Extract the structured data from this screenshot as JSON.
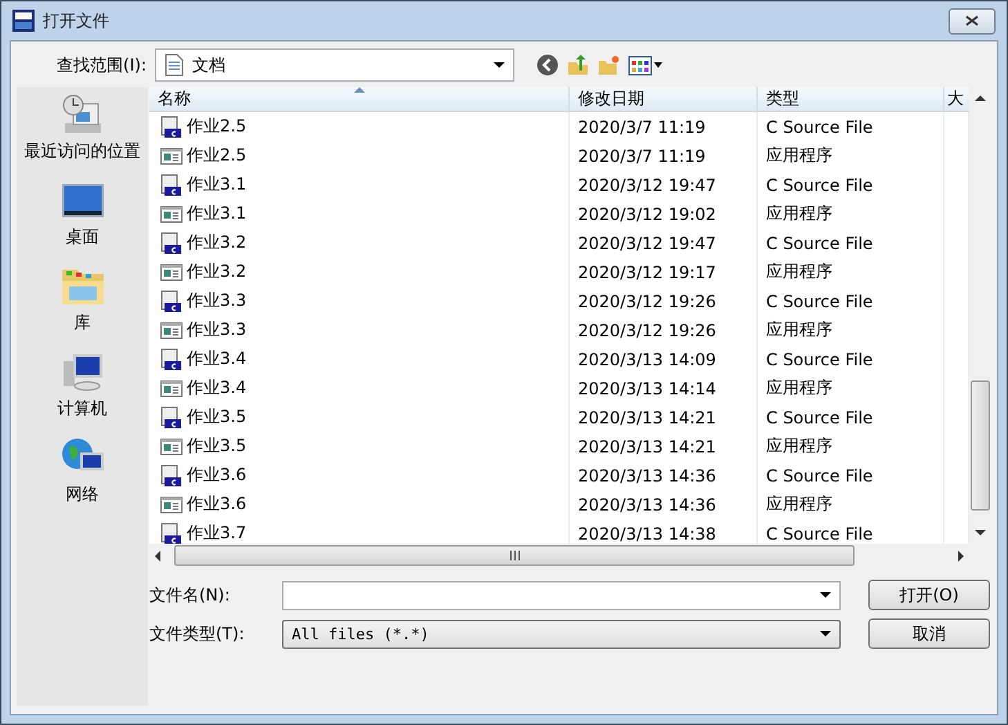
{
  "window": {
    "title": "打开文件"
  },
  "look_in": {
    "label": "查找范围(I):",
    "value": "文档"
  },
  "places": [
    {
      "kind": "recent",
      "label": "最近访问的位置"
    },
    {
      "kind": "desktop",
      "label": "桌面"
    },
    {
      "kind": "library",
      "label": "库"
    },
    {
      "kind": "computer",
      "label": "计算机"
    },
    {
      "kind": "network",
      "label": "网络"
    }
  ],
  "columns": [
    "名称",
    "修改日期",
    "类型",
    "大"
  ],
  "files": [
    {
      "kind": "source",
      "name": "作业2.5",
      "date": "2020/3/7 11:19",
      "type": "C Source File"
    },
    {
      "kind": "exe",
      "name": "作业2.5",
      "date": "2020/3/7 11:19",
      "type": "应用程序"
    },
    {
      "kind": "source",
      "name": "作业3.1",
      "date": "2020/3/12 19:47",
      "type": "C Source File"
    },
    {
      "kind": "exe",
      "name": "作业3.1",
      "date": "2020/3/12 19:02",
      "type": "应用程序"
    },
    {
      "kind": "source",
      "name": "作业3.2",
      "date": "2020/3/12 19:47",
      "type": "C Source File"
    },
    {
      "kind": "exe",
      "name": "作业3.2",
      "date": "2020/3/12 19:17",
      "type": "应用程序"
    },
    {
      "kind": "source",
      "name": "作业3.3",
      "date": "2020/3/12 19:26",
      "type": "C Source File"
    },
    {
      "kind": "exe",
      "name": "作业3.3",
      "date": "2020/3/12 19:26",
      "type": "应用程序"
    },
    {
      "kind": "source",
      "name": "作业3.4",
      "date": "2020/3/13 14:09",
      "type": "C Source File"
    },
    {
      "kind": "exe",
      "name": "作业3.4",
      "date": "2020/3/13 14:14",
      "type": "应用程序"
    },
    {
      "kind": "source",
      "name": "作业3.5",
      "date": "2020/3/13 14:21",
      "type": "C Source File"
    },
    {
      "kind": "exe",
      "name": "作业3.5",
      "date": "2020/3/13 14:21",
      "type": "应用程序"
    },
    {
      "kind": "source",
      "name": "作业3.6",
      "date": "2020/3/13 14:36",
      "type": "C Source File"
    },
    {
      "kind": "exe",
      "name": "作业3.6",
      "date": "2020/3/13 14:36",
      "type": "应用程序"
    },
    {
      "kind": "source",
      "name": "作业3.7",
      "date": "2020/3/13 14:38",
      "type": "C Source File"
    }
  ],
  "filename": {
    "label": "文件名(N):"
  },
  "filetype": {
    "label": "文件类型(T):",
    "value": "All files (*.*)"
  },
  "buttons": [
    "打开(O)",
    "取消"
  ]
}
